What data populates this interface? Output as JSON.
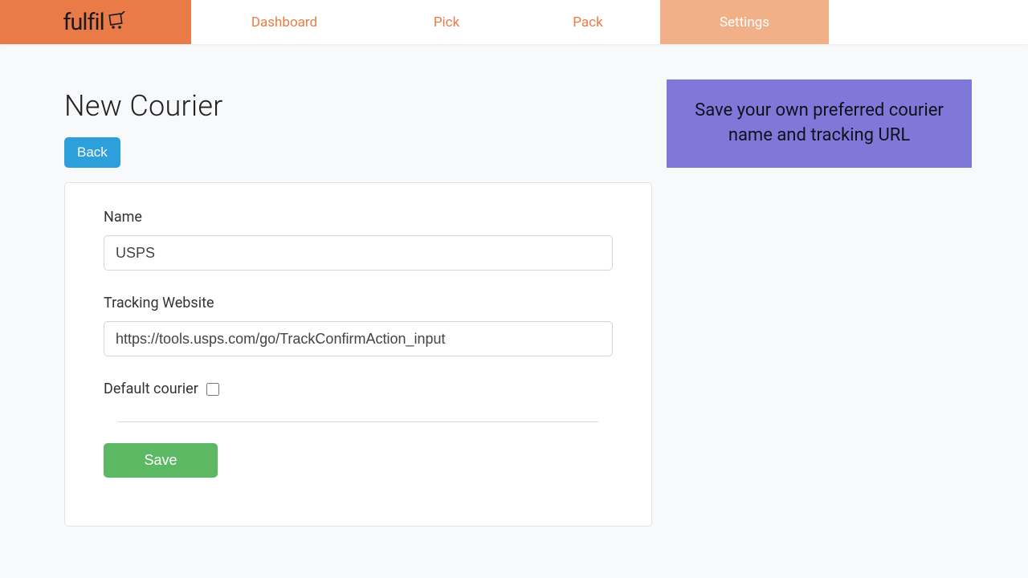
{
  "nav": {
    "logo_text": "fulfil",
    "items": {
      "dashboard": "Dashboard",
      "pick": "Pick",
      "pack": "Pack",
      "settings": "Settings"
    }
  },
  "page": {
    "title": "New Courier",
    "back_label": "Back"
  },
  "form": {
    "name_label": "Name",
    "name_value": "USPS",
    "tracking_label": "Tracking Website",
    "tracking_value": "https://tools.usps.com/go/TrackConfirmAction_input",
    "default_label": "Default courier",
    "default_checked": false,
    "save_label": "Save"
  },
  "info": {
    "text": "Save your own preferred courier name and tracking URL"
  }
}
